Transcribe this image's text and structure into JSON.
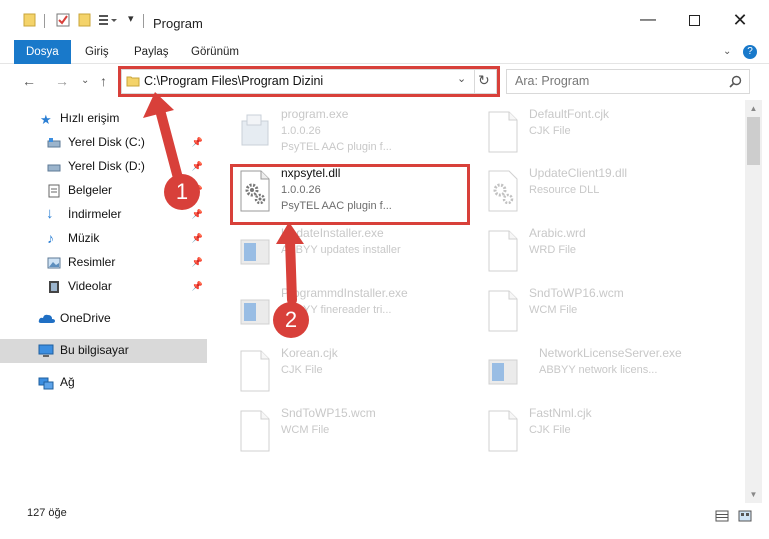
{
  "window": {
    "title": "Program"
  },
  "ribbon": {
    "tabs": [
      "Dosya",
      "Giriş",
      "Paylaş",
      "Görünüm"
    ]
  },
  "address": {
    "path": "C:\\Program Files\\Program Dizini"
  },
  "search": {
    "placeholder": "Ara: Program"
  },
  "sidebar": {
    "items": [
      {
        "label": "Hızlı erişim",
        "icon": "star-icon"
      },
      {
        "label": "Yerel Disk (C:)",
        "icon": "drive-icon"
      },
      {
        "label": "Yerel Disk (D:)",
        "icon": "drive-icon"
      },
      {
        "label": "Belgeler",
        "icon": "documents-icon"
      },
      {
        "label": "İndirmeler",
        "icon": "download-icon"
      },
      {
        "label": "Müzik",
        "icon": "music-icon"
      },
      {
        "label": "Resimler",
        "icon": "pictures-icon"
      },
      {
        "label": "Videolar",
        "icon": "videos-icon"
      },
      {
        "label": "OneDrive",
        "icon": "cloud-icon"
      },
      {
        "label": "Bu bilgisayar",
        "icon": "computer-icon"
      },
      {
        "label": "Ağ",
        "icon": "network-icon"
      }
    ]
  },
  "files": {
    "left": [
      {
        "name": "program.exe",
        "line2": "1.0.0.26",
        "line3": "PsyTEL AAC plugin f...",
        "icon": "exe-icon"
      },
      {
        "name": "nxpsytel.dll",
        "line2": "1.0.0.26",
        "line3": "PsyTEL AAC plugin f...",
        "icon": "dll-gear-icon"
      },
      {
        "name": "UpdateInstaller.exe",
        "line2": "ABBYY updates installer",
        "line3": "",
        "icon": "installer-icon"
      },
      {
        "name": "ProgrammdInstaller.exe",
        "line2": "ABBYY finereader tri...",
        "line3": "",
        "icon": "installer-icon"
      },
      {
        "name": "Korean.cjk",
        "line2": "CJK File",
        "line3": "",
        "icon": "blank-file-icon"
      },
      {
        "name": "SndToWP15.wcm",
        "line2": "WCM File",
        "line3": "",
        "icon": "blank-file-icon"
      }
    ],
    "right": [
      {
        "name": "DefaultFont.cjk",
        "line2": "CJK File",
        "line3": "",
        "icon": "blank-file-icon"
      },
      {
        "name": "UpdateClient19.dll",
        "line2": "Resource DLL",
        "line3": "",
        "icon": "dll-gear-icon"
      },
      {
        "name": "Arabic.wrd",
        "line2": "WRD File",
        "line3": "",
        "icon": "blank-file-icon"
      },
      {
        "name": "SndToWP16.wcm",
        "line2": "WCM File",
        "line3": "",
        "icon": "blank-file-icon"
      },
      {
        "name": "NetworkLicenseServer.exe",
        "line2": "ABBYY network licens...",
        "line3": "",
        "icon": "installer-icon"
      },
      {
        "name": "FastNml.cjk",
        "line2": "CJK File",
        "line3": "",
        "icon": "blank-file-icon"
      }
    ]
  },
  "status": {
    "count": "127 öğe"
  },
  "annotations": {
    "badge1": "1",
    "badge2": "2",
    "color": "#d8403a"
  }
}
